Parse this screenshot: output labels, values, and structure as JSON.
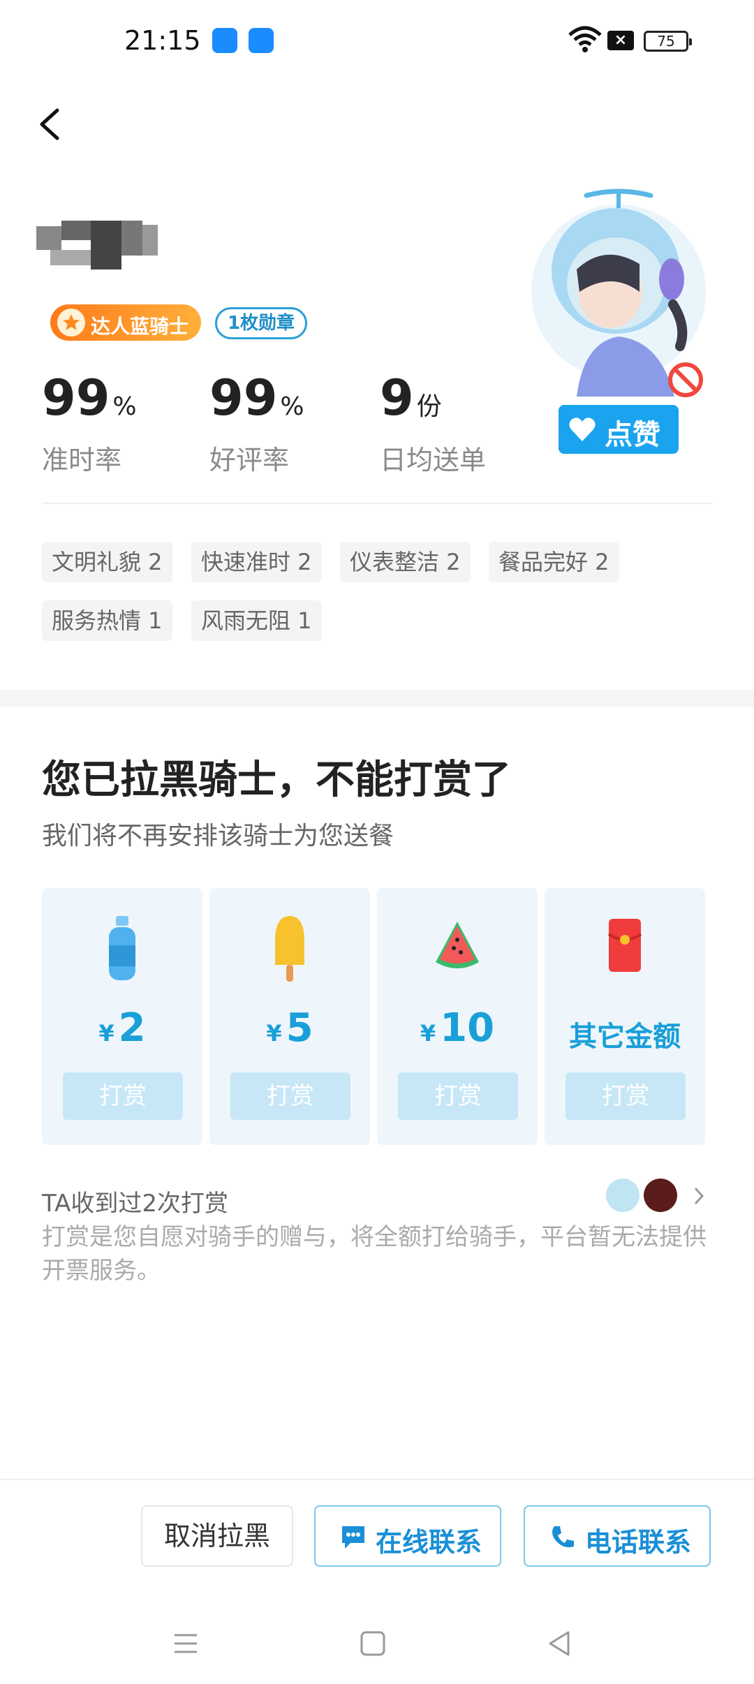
{
  "status_bar": {
    "time": "21:15",
    "battery": "75",
    "icons": [
      "eleme-app-icon",
      "shield-app-icon",
      "wifi-icon",
      "sim-disabled-icon",
      "battery-icon"
    ]
  },
  "rider": {
    "level_badge": "达人蓝骑士",
    "medal_badge": "1枚勋章",
    "stats": [
      {
        "value": "99",
        "unit": "%",
        "label": "准时率"
      },
      {
        "value": "99",
        "unit": "%",
        "label": "好评率"
      },
      {
        "value": "9",
        "unit": "份",
        "label": "日均送单"
      }
    ],
    "like_button": "点赞"
  },
  "tags": [
    {
      "label": "文明礼貌 2"
    },
    {
      "label": "快速准时 2"
    },
    {
      "label": "仪表整洁 2"
    },
    {
      "label": "餐品完好 2"
    },
    {
      "label": "服务热情 1"
    },
    {
      "label": "风雨无阻 1"
    }
  ],
  "tip_section": {
    "title": "您已拉黑骑士，不能打赏了",
    "subtitle": "我们将不再安排该骑士为您送餐",
    "options": [
      {
        "icon": "water-bottle-icon",
        "currency": "¥",
        "amount": "2",
        "button": "打赏"
      },
      {
        "icon": "popsicle-icon",
        "currency": "¥",
        "amount": "5",
        "button": "打赏"
      },
      {
        "icon": "watermelon-icon",
        "currency": "¥",
        "amount": "10",
        "button": "打赏"
      },
      {
        "icon": "red-envelope-icon",
        "currency": "",
        "amount": "其它金额",
        "button": "打赏"
      }
    ],
    "tip_count": "TA收到过2次打赏",
    "disclaimer": "打赏是您自愿对骑手的赠与，将全额打给骑手，平台暂无法提供开票服务。"
  },
  "actions": {
    "unblock": "取消拉黑",
    "online_contact": "在线联系",
    "phone_contact": "电话联系"
  },
  "colors": {
    "accent_blue": "#1aa3ee",
    "badge_orange": "#ff8a1f",
    "tip_card_bg": "#eef6fb",
    "tip_button_disabled": "#c7e7f7"
  }
}
